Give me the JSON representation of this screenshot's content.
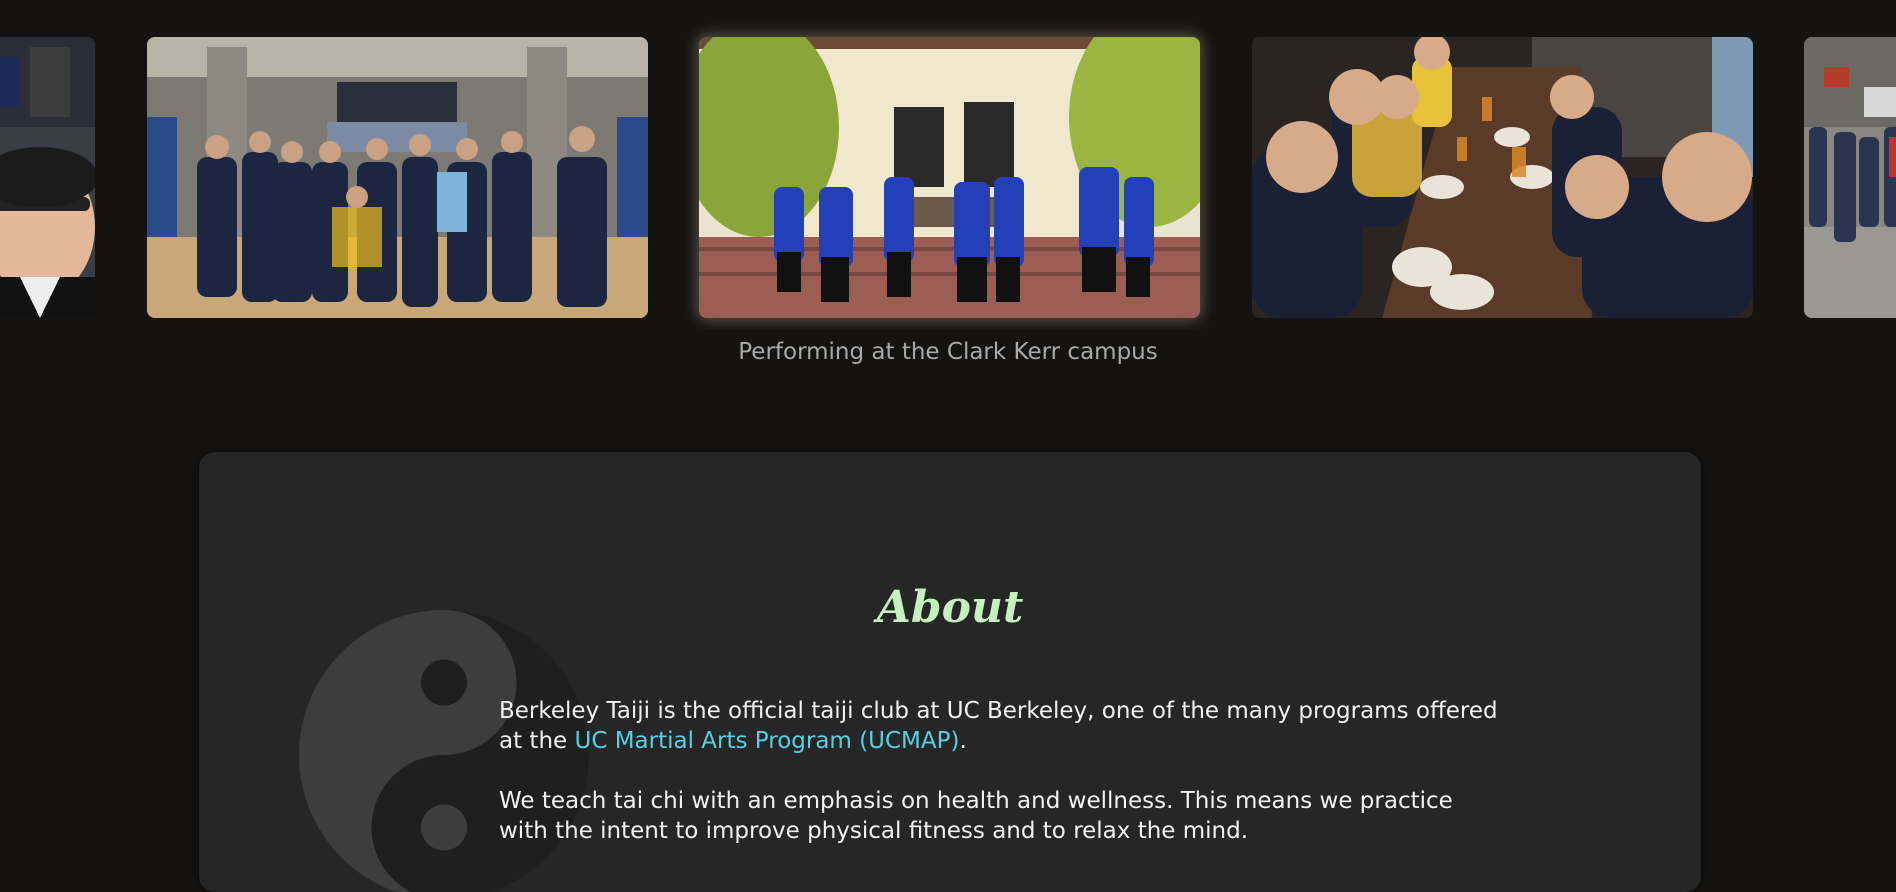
{
  "carousel": {
    "caption": "Performing at the Clark Kerr campus",
    "photos": [
      {
        "description_icon": "selfie-photo"
      },
      {
        "description_icon": "group-photo-gym"
      },
      {
        "description_icon": "performance-photo-courtyard"
      },
      {
        "description_icon": "restaurant-selfie-photo"
      },
      {
        "description_icon": "street-crowd-photo"
      }
    ],
    "active_index": 2
  },
  "about": {
    "title": "About",
    "p1_before": "Berkeley Taiji is the official taiji club at UC Berkeley, one of the many programs offered at the ",
    "p1_link": "UC Martial Arts Program (UCMAP)",
    "p1_after": ".",
    "p2": "We teach tai chi with an emphasis on health and wellness. This means we practice with the intent to improve physical fitness and to relax the mind."
  },
  "colors": {
    "background": "#141311",
    "card": "#262626",
    "title": "#c6f0c0",
    "link": "#53d2e6",
    "caption": "#a9a9a9"
  }
}
